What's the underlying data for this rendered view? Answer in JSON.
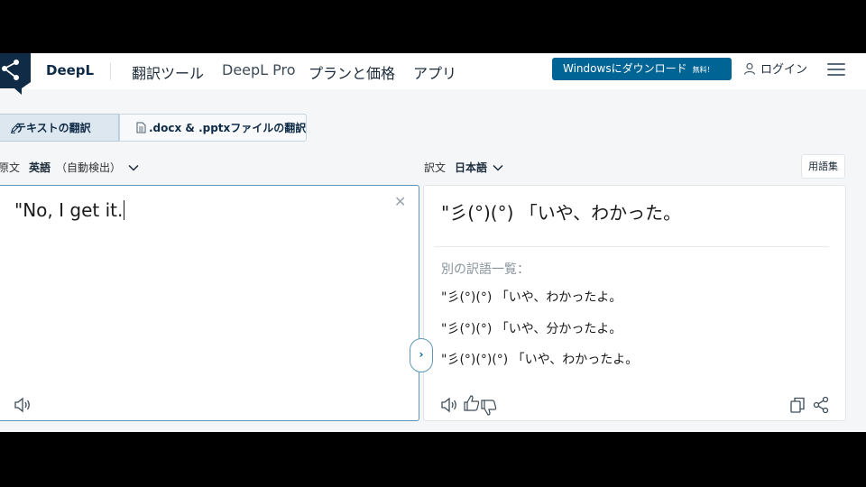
{
  "header": {
    "brand": "DeepL",
    "nav": [
      "翻訳ツール",
      "DeepL Pro",
      "プランと価格",
      "アプリ"
    ],
    "download_label": "Windowsにダウンロード",
    "download_badge": "無料！",
    "login_label": "ログイン"
  },
  "tabs": {
    "text_label": "テキストの翻訳",
    "doc_label": ".docx & .pptxファイルの翻訳"
  },
  "source": {
    "label": "原文",
    "language": "英語",
    "detect": "（自動検出）",
    "text": "\"No, I get it."
  },
  "target": {
    "label": "訳文",
    "language": "日本語",
    "glossary_label": "用語集",
    "translation": "\"彡(°)(°) 「いや、わかった。",
    "alternatives_heading": "別の訳語一覧：",
    "alternatives": [
      "\"彡(°)(°) 「いや、わかったよ。",
      "\"彡(°)(°) 「いや、分かったよ。",
      "\"彡(°)(°)(°) 「いや、わかったよ。"
    ]
  },
  "colors": {
    "accent": "#006494",
    "brand_dark": "#0f2b46",
    "focus_border": "#5f97b8"
  }
}
